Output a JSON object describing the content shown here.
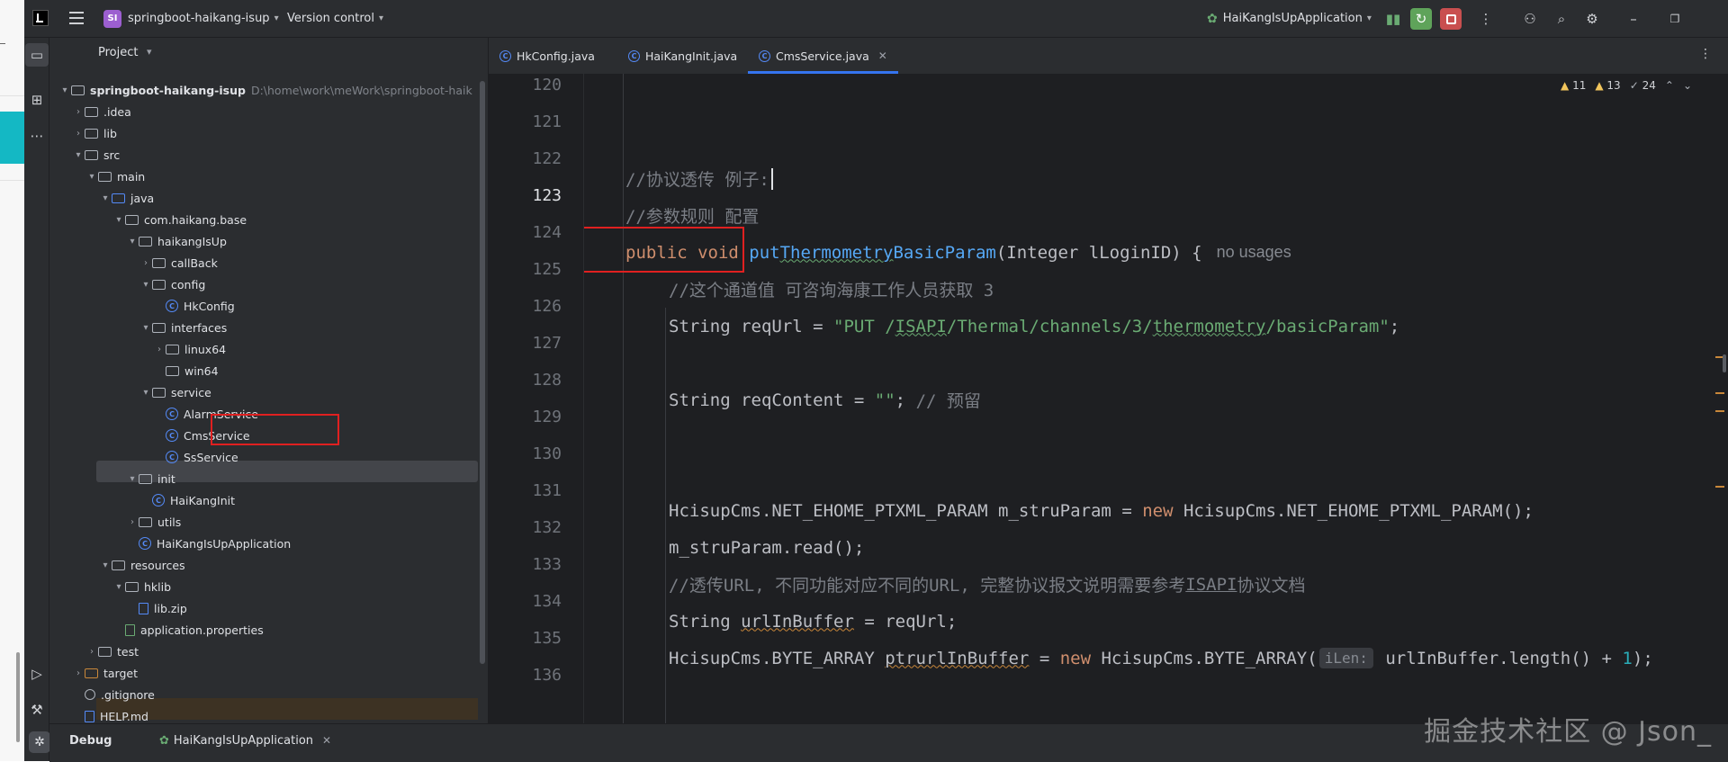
{
  "titlebar": {
    "project_badge": "SI",
    "project_name": "springboot-haikang-isup",
    "version_control": "Version control",
    "run_config": "HaiKangIsUpApplication"
  },
  "project_panel": {
    "title": "Project",
    "tree": [
      {
        "label": "springboot-haikang-isup",
        "hint": "D:\\home\\work\\meWork\\springboot-haik",
        "depth": 0,
        "arrow": "▾",
        "icon": "folder"
      },
      {
        "label": ".idea",
        "depth": 1,
        "arrow": "›",
        "icon": "folder"
      },
      {
        "label": "lib",
        "depth": 1,
        "arrow": "›",
        "icon": "folder"
      },
      {
        "label": "src",
        "depth": 1,
        "arrow": "▾",
        "icon": "folder"
      },
      {
        "label": "main",
        "depth": 2,
        "arrow": "▾",
        "icon": "folder"
      },
      {
        "label": "java",
        "depth": 3,
        "arrow": "▾",
        "icon": "folder-blue"
      },
      {
        "label": "com.haikang.base",
        "depth": 4,
        "arrow": "▾",
        "icon": "folder"
      },
      {
        "label": "haikangIsUp",
        "depth": 5,
        "arrow": "▾",
        "icon": "folder"
      },
      {
        "label": "callBack",
        "depth": 6,
        "arrow": "›",
        "icon": "folder"
      },
      {
        "label": "config",
        "depth": 6,
        "arrow": "▾",
        "icon": "folder"
      },
      {
        "label": "HkConfig",
        "depth": 7,
        "arrow": "",
        "icon": "class"
      },
      {
        "label": "interfaces",
        "depth": 6,
        "arrow": "▾",
        "icon": "folder"
      },
      {
        "label": "linux64",
        "depth": 7,
        "arrow": "›",
        "icon": "folder"
      },
      {
        "label": "win64",
        "depth": 7,
        "arrow": "",
        "icon": "folder"
      },
      {
        "label": "service",
        "depth": 6,
        "arrow": "▾",
        "icon": "folder"
      },
      {
        "label": "AlarmService",
        "depth": 7,
        "arrow": "",
        "icon": "class"
      },
      {
        "label": "CmsService",
        "depth": 7,
        "arrow": "",
        "icon": "class"
      },
      {
        "label": "SsService",
        "depth": 7,
        "arrow": "",
        "icon": "class"
      },
      {
        "label": "init",
        "depth": 5,
        "arrow": "▾",
        "icon": "folder"
      },
      {
        "label": "HaiKangInit",
        "depth": 6,
        "arrow": "",
        "icon": "class"
      },
      {
        "label": "utils",
        "depth": 5,
        "arrow": "›",
        "icon": "folder"
      },
      {
        "label": "HaiKangIsUpApplication",
        "depth": 5,
        "arrow": "",
        "icon": "class"
      },
      {
        "label": "resources",
        "depth": 3,
        "arrow": "▾",
        "icon": "folder"
      },
      {
        "label": "hklib",
        "depth": 4,
        "arrow": "▾",
        "icon": "folder"
      },
      {
        "label": "lib.zip",
        "depth": 5,
        "arrow": "",
        "icon": "file"
      },
      {
        "label": "application.properties",
        "depth": 4,
        "arrow": "",
        "icon": "file-green"
      },
      {
        "label": "test",
        "depth": 2,
        "arrow": "›",
        "icon": "folder"
      },
      {
        "label": "target",
        "depth": 1,
        "arrow": "›",
        "icon": "folder-orange"
      },
      {
        "label": ".gitignore",
        "depth": 1,
        "arrow": "",
        "icon": "circle"
      },
      {
        "label": "HELP.md",
        "depth": 1,
        "arrow": "",
        "icon": "file"
      }
    ]
  },
  "editor": {
    "tabs": [
      {
        "label": "HkConfig.java",
        "active": false
      },
      {
        "label": "HaiKangInit.java",
        "active": false
      },
      {
        "label": "CmsService.java",
        "active": true
      }
    ],
    "inspections": {
      "warnings": "11",
      "weak": "13",
      "typos": "24"
    },
    "line_numbers": [
      "120",
      "121",
      "122",
      "123",
      "124",
      "125",
      "126",
      "127",
      "128",
      "129",
      "130",
      "131",
      "132",
      "133",
      "134",
      "135",
      "136"
    ],
    "top_fragment": "}",
    "code": {
      "l123": "//协议透传 例子:",
      "l124": "//参数规则 配置",
      "l125_kw": "public void ",
      "l125_fn_a": "put",
      "l125_fn_b": "Thermometry",
      "l125_fn_c": "BasicParam",
      "l125_rest": "(Integer lLoginID) {",
      "l125_hint": "no usages",
      "l126": "//这个通道值 可咨询海康工作人员获取 3",
      "l127_a": "String reqUrl = ",
      "l127_str_a": "\"PUT /",
      "l127_str_b": "ISAPI",
      "l127_str_c": "/Thermal/channels/3/",
      "l127_str_d": "thermometry",
      "l127_str_e": "/basicParam\"",
      "l127_end": ";",
      "l129_a": "String reqContent = ",
      "l129_str": "\"\"",
      "l129_b": "; ",
      "l129_cm": "// 预留",
      "l132_a": "HcisupCms.NET_EHOME_PTXML_PARAM m_struParam = ",
      "l132_kw": "new",
      "l132_b": " HcisupCms.NET_EHOME_PTXML_PARAM();",
      "l133": "m_struParam.read();",
      "l134_a": "//透传URL, 不同功能对应不同的URL, 完整协议报文说明需要参考",
      "l134_b": "ISAPI",
      "l134_c": "协议文档",
      "l135_a": "String ",
      "l135_var": "urlInBuffer",
      "l135_b": " = reqUrl;",
      "l136_a": "HcisupCms.BYTE_ARRAY ",
      "l136_var": "ptrurlInBuffer",
      "l136_b": " = ",
      "l136_kw": "new",
      "l136_c": " HcisupCms.BYTE_ARRAY(",
      "l136_inlay": "iLen:",
      "l136_d": " urlInBuffer.length() + ",
      "l136_num": "1",
      "l136_e": ");"
    }
  },
  "debug_bar": {
    "label": "Debug",
    "session": "HaiKangIsUpApplication"
  },
  "watermark": "掘金技术社区 @ Json_",
  "colors": {
    "ide_bg": "#2b2d30",
    "editor_bg": "#1e1f22",
    "keyword": "#cf8e6d",
    "comment": "#7a7e85",
    "string": "#6aab73",
    "accent": "#3574f0",
    "highlight_box": "#e02020"
  }
}
